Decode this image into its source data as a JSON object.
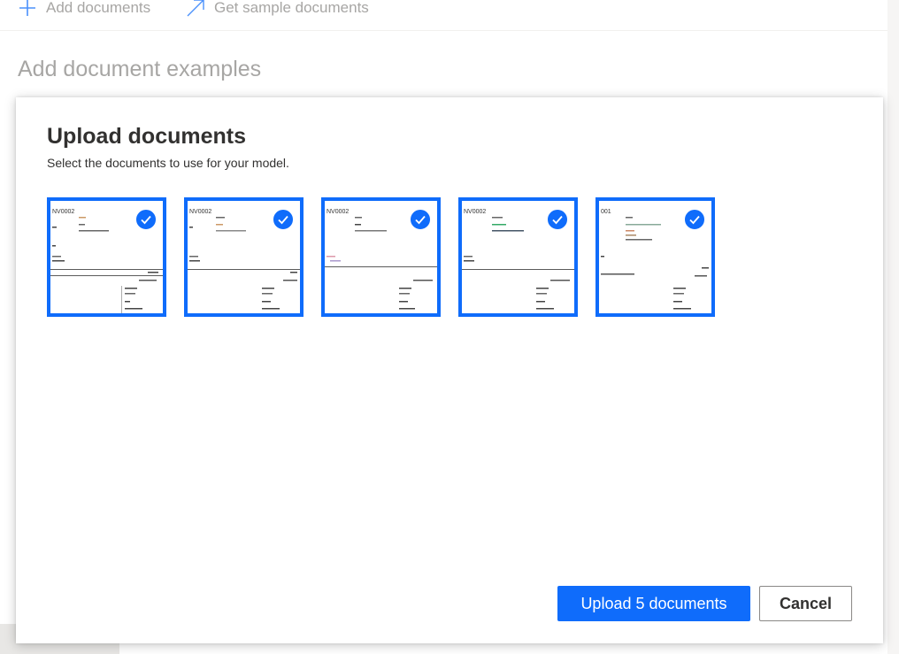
{
  "toolbar": {
    "add_documents": "Add documents",
    "get_sample_documents": "Get sample documents"
  },
  "background": {
    "heading": "Add document examples"
  },
  "dialog": {
    "title": "Upload documents",
    "subtitle": "Select the documents to use for your model.",
    "documents": [
      {
        "header": "NV0002",
        "selected": true
      },
      {
        "header": "NV0002",
        "selected": true
      },
      {
        "header": "NV0002",
        "selected": true
      },
      {
        "header": "NV0002",
        "selected": true
      },
      {
        "header": "001",
        "selected": true
      }
    ],
    "upload_button": "Upload 5 documents",
    "cancel_button": "Cancel"
  },
  "icons": {
    "add": "plus-icon",
    "sample": "arrow-up-right-icon",
    "selected": "checkmark-icon"
  },
  "colors": {
    "accent": "#0f6cfb",
    "text": "#323130",
    "muted": "#8a8886"
  }
}
